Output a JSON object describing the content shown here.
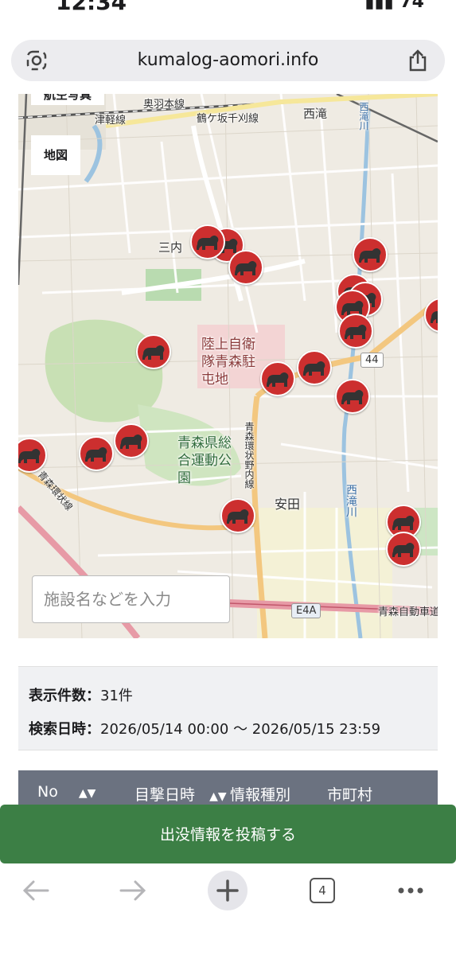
{
  "status": {
    "time": "12:34",
    "battery": "74"
  },
  "browser": {
    "url": "kumalog-aomori.info"
  },
  "map": {
    "layer_toggle_top": "航空写真",
    "layer_toggle": "地図",
    "search_placeholder": "施設名などを入力",
    "labels": {
      "ou_line": "奥羽本線",
      "tsugaru_line": "津軽線",
      "gonohe_line": "鶴ケ坂千刈線",
      "nishitaki": "西滝",
      "sannai": "三内",
      "jsdf": "陸上自衛隊青森駐屯地",
      "park": "青森県総合運動公園",
      "yasuda": "安田",
      "ring_road": "青森環状野内線",
      "loop": "青森環状線",
      "nishitakigawa": "西滝川",
      "route44": "44",
      "e4a": "E4A",
      "expressway": "青森自動車道",
      "nishitakigawa_top": "西滝川"
    },
    "marker_icon": "bear-icon",
    "marker_color": "#cc2f2f",
    "marker_count_visible": 20
  },
  "summary": {
    "count_label": "表示件数：",
    "count_value": "31件",
    "date_label": "検索日時：",
    "date_value": "2026/05/14 00:00 〜 2026/05/15 23:59"
  },
  "table": {
    "columns": [
      "No",
      "目撃日時",
      "情報種別",
      "市町村"
    ]
  },
  "actions": {
    "post_button": "出没情報を投稿する"
  },
  "toolbar": {
    "tab_count": "4"
  }
}
